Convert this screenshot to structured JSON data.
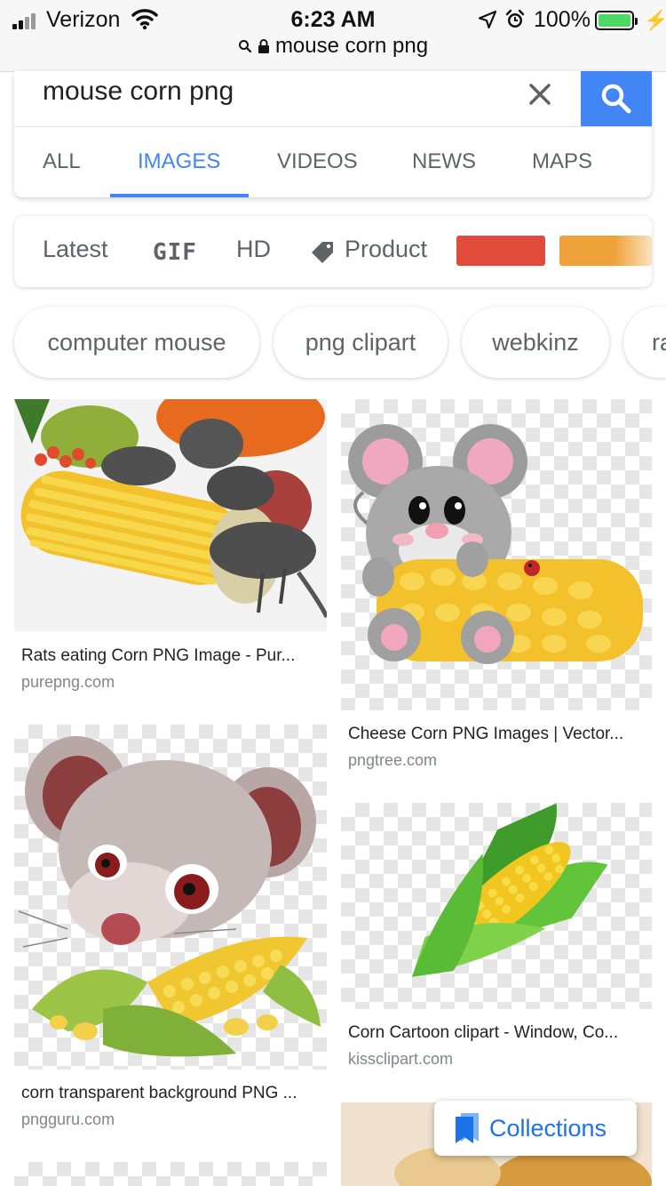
{
  "status_bar": {
    "carrier": "Verizon",
    "time": "6:23 AM",
    "battery_percent": "100%",
    "battery_level": 1.0,
    "url": "mouse corn png"
  },
  "search": {
    "query": "mouse corn png",
    "clear_icon": "close-icon",
    "search_icon": "search-icon",
    "accent": "#4285f4"
  },
  "tabs": [
    {
      "label": "ALL"
    },
    {
      "label": "IMAGES",
      "active": true
    },
    {
      "label": "VIDEOS"
    },
    {
      "label": "NEWS"
    },
    {
      "label": "MAPS"
    }
  ],
  "filters": {
    "latest": "Latest",
    "gif": "GIF",
    "hd": "HD",
    "product": "Product",
    "swatches": [
      "#e14b3b",
      "#f0a23a"
    ]
  },
  "suggestions": [
    {
      "label": "computer mouse"
    },
    {
      "label": "png clipart"
    },
    {
      "label": "webkinz"
    },
    {
      "label": "ra"
    }
  ],
  "results": [
    {
      "title": "Rats eating Corn PNG Image - Pur...",
      "source": "purepng.com"
    },
    {
      "title": "Cheese Corn PNG Images | Vector...",
      "source": "pngtree.com"
    },
    {
      "title": "corn transparent background PNG ...",
      "source": "pngguru.com"
    },
    {
      "title": "Corn Cartoon clipart - Window, Co...",
      "source": "kissclipart.com"
    }
  ],
  "collections": {
    "label": "Collections"
  }
}
